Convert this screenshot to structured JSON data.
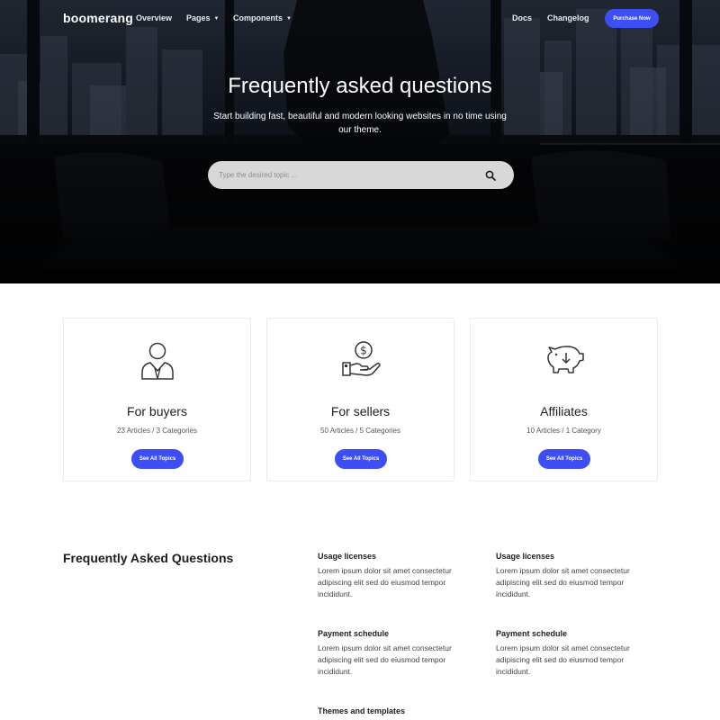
{
  "nav": {
    "brand": "boomerang",
    "links": [
      "Overview",
      "Pages",
      "Components",
      "Docs",
      "Changelog"
    ],
    "purchase_label": "Purchase Now"
  },
  "hero": {
    "title": "Frequently asked questions",
    "subtitle": "Start building fast, beautiful and modern looking websites in no time using our theme.",
    "search_placeholder": "Type the desired topic ..."
  },
  "cards": [
    {
      "title": "For buyers",
      "meta": "23 Articles / 3 Categories",
      "button": "See All Topics",
      "icon": "user-icon"
    },
    {
      "title": "For sellers",
      "meta": "50 Articles / 5 Categories",
      "button": "See All Topics",
      "icon": "dollar-hand-icon"
    },
    {
      "title": "Affiliates",
      "meta": "10 Articles / 1 Category",
      "button": "See All Topics",
      "icon": "piggy-bank-icon"
    }
  ],
  "faq": {
    "heading": "Frequently Asked Questions",
    "items": [
      {
        "question": "Usage licenses",
        "answer": "Lorem ipsum dolor sit amet consectetur adipiscing elit sed do eiusmod tempor incididunt."
      },
      {
        "question": "Usage licenses",
        "answer": "Lorem ipsum dolor sit amet consectetur adipiscing elit sed do eiusmod tempor incididunt."
      },
      {
        "question": "Payment schedule",
        "answer": "Lorem ipsum dolor sit amet consectetur adipiscing elit sed do eiusmod tempor incididunt."
      },
      {
        "question": "Payment schedule",
        "answer": "Lorem ipsum dolor sit amet consectetur adipiscing elit sed do eiusmod tempor incididunt."
      },
      {
        "question": "Themes and templates",
        "answer": ""
      }
    ]
  },
  "colors": {
    "accent": "#3d4ef5",
    "hero_dark": "#0c0f15",
    "card_border": "#ececec"
  }
}
